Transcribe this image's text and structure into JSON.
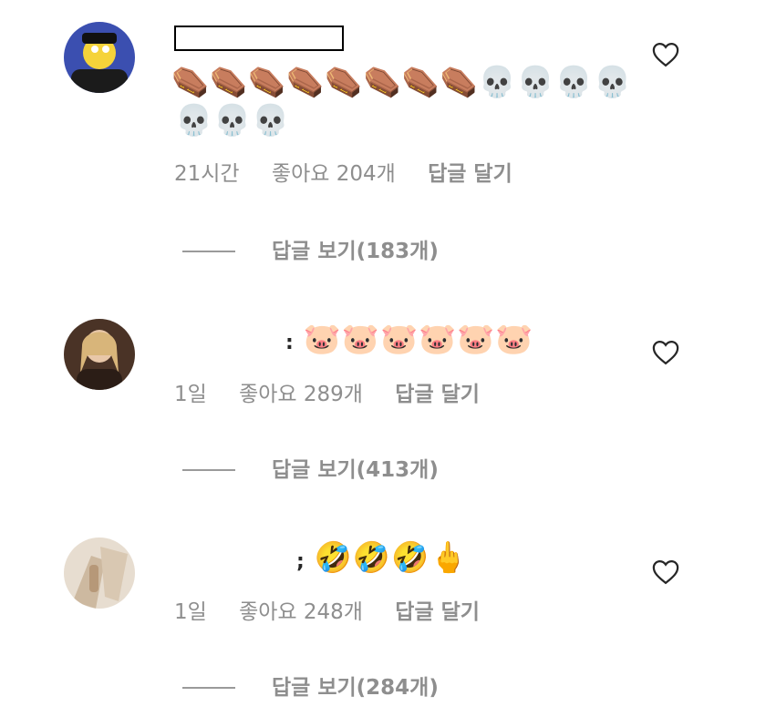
{
  "comments": [
    {
      "avatar_label": "cartoon-character-avatar",
      "text_line1": "⚰️⚰️⚰️⚰️⚰️⚰️⚰️⚰️💀💀💀💀",
      "text_line2": "💀💀💀",
      "time": "21시간",
      "likes": "좋아요 204개",
      "reply": "답글 달기",
      "view_replies": "답글 보기(183개)"
    },
    {
      "avatar_label": "portrait-photo-avatar",
      "handle_fragment": ":",
      "text_line1": "🐷🐷🐷🐷🐷🐷",
      "time": "1일",
      "likes": "좋아요 289개",
      "reply": "답글 달기",
      "view_replies": "답글 보기(413개)"
    },
    {
      "avatar_label": "blurred-photo-avatar",
      "handle_fragment": ";",
      "text_line1": "🤣🤣🤣🖕",
      "time": "1일",
      "likes": "좋아요 248개",
      "reply": "답글 달기",
      "view_replies": "답글 보기(284개)"
    }
  ],
  "icons": {
    "like": "heart-outline-icon"
  },
  "colors": {
    "meta_text": "#8e8e8e",
    "primary_text": "#262626",
    "background": "#ffffff"
  }
}
